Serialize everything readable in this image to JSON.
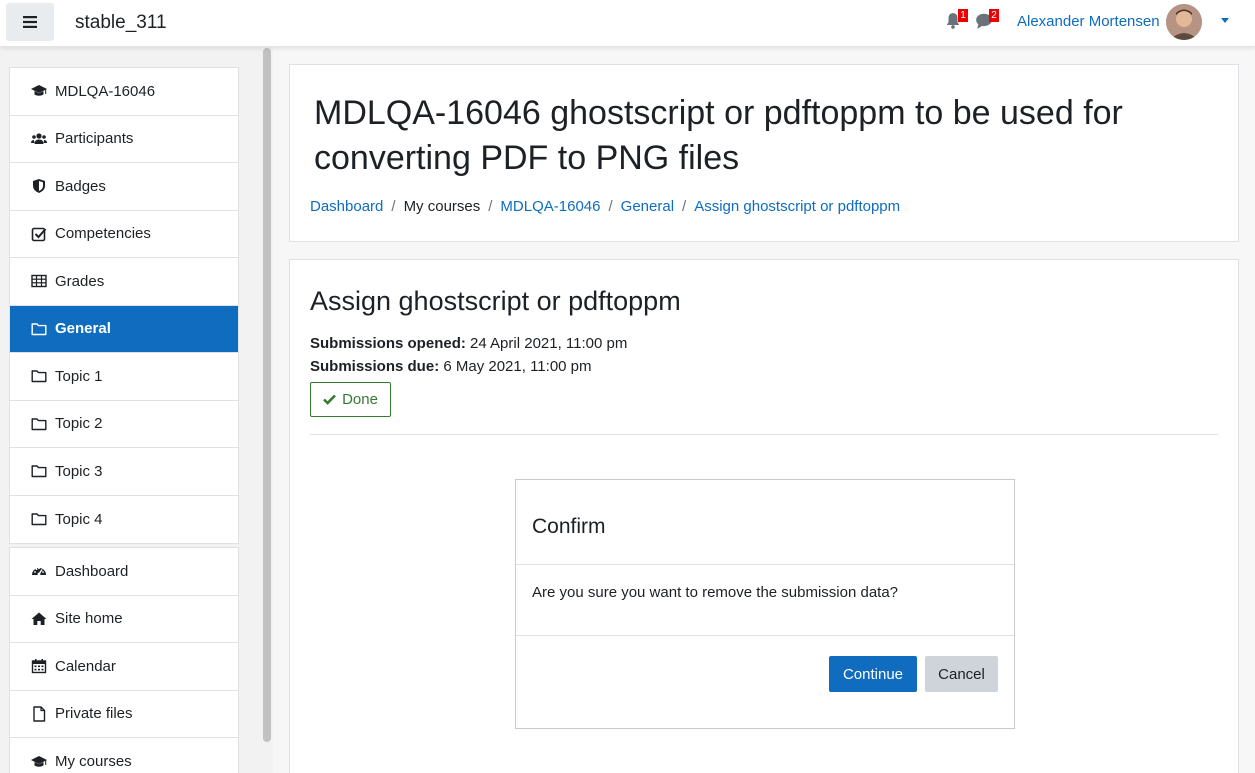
{
  "navbar": {
    "site_name": "stable_311",
    "notifications_count": "1",
    "messages_count": "2",
    "user_name": "Alexander Mortensen"
  },
  "drawer": {
    "course_items": [
      {
        "label": "MDLQA-16046",
        "icon": "graduation-cap-icon"
      },
      {
        "label": "Participants",
        "icon": "users-icon"
      },
      {
        "label": "Badges",
        "icon": "shield-icon"
      },
      {
        "label": "Competencies",
        "icon": "check-square-icon"
      },
      {
        "label": "Grades",
        "icon": "table-icon"
      },
      {
        "label": "General",
        "icon": "folder-icon",
        "active": true
      },
      {
        "label": "Topic 1",
        "icon": "folder-icon"
      },
      {
        "label": "Topic 2",
        "icon": "folder-icon"
      },
      {
        "label": "Topic 3",
        "icon": "folder-icon"
      },
      {
        "label": "Topic 4",
        "icon": "folder-icon"
      }
    ],
    "site_items": [
      {
        "label": "Dashboard",
        "icon": "dashboard-icon"
      },
      {
        "label": "Site home",
        "icon": "home-icon"
      },
      {
        "label": "Calendar",
        "icon": "calendar-icon"
      },
      {
        "label": "Private files",
        "icon": "file-icon"
      },
      {
        "label": "My courses",
        "icon": "graduation-cap-icon"
      }
    ]
  },
  "header": {
    "title": "MDLQA-16046 ghostscript or pdftoppm to be used for converting PDF to PNG files",
    "breadcrumb": [
      {
        "label": "Dashboard",
        "link": true
      },
      {
        "label": "My courses",
        "link": false
      },
      {
        "label": "MDLQA-16046",
        "link": true
      },
      {
        "label": "General",
        "link": true
      },
      {
        "label": "Assign ghostscript or pdftoppm",
        "link": true
      }
    ]
  },
  "assignment": {
    "title": "Assign ghostscript or pdftoppm",
    "opened_label": "Submissions opened:",
    "opened_value": "24 April 2021, 11:00 pm",
    "due_label": "Submissions due:",
    "due_value": "6 May 2021, 11:00 pm",
    "done_label": "Done"
  },
  "modal": {
    "title": "Confirm",
    "body": "Are you sure you want to remove the submission data?",
    "continue_label": "Continue",
    "cancel_label": "Cancel"
  },
  "colors": {
    "primary": "#0f6cbf",
    "success": "#357a32",
    "badge": "#ee0000"
  }
}
